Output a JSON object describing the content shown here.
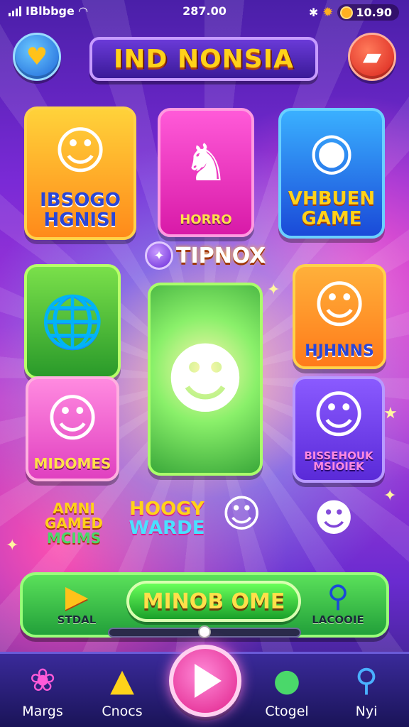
{
  "status_bar": {
    "carrier": "IBlbbge",
    "time": "287.00",
    "currency": "10.90"
  },
  "header": {
    "title": "IND NONSIA",
    "heart_icon": "heart-icon",
    "chest_icon": "chest-icon"
  },
  "cards": {
    "card1": {
      "label_line1": "IBSOGO",
      "label_line2": "HGNISI"
    },
    "card2": {
      "label": "HORRO"
    },
    "card3": {
      "label_line1": "VHBUEN",
      "label_line2": "GAME"
    },
    "card6": {
      "label": "HJHNNS"
    },
    "card7": {
      "label": "MIDOMES"
    },
    "card8": {
      "label_line1": "BISSEHOUK",
      "label_line2": "MSIOIEK"
    }
  },
  "featured_tag": "TIPNOX",
  "floating_labels": {
    "left": {
      "line1": "AMNI",
      "line2": "GAMED",
      "line3": "MCIMS"
    },
    "center": {
      "line1": "HOOGY",
      "line2": "WARDE"
    }
  },
  "panel": {
    "left_label": "STDAL",
    "cta_label": "MINOB OME",
    "right_label": "LACOOIE",
    "slider_value": 0.5
  },
  "nav": {
    "items": [
      {
        "label": "Margs",
        "icon": "berry-icon"
      },
      {
        "label": "Cnocs",
        "icon": "nacho-icon"
      },
      {
        "label": "Ctogel",
        "icon": "orb-icon"
      },
      {
        "label": "Nyi",
        "icon": "search-icon"
      }
    ],
    "play_icon": "play-icon"
  },
  "colors": {
    "title_text": "#ffd21a",
    "panel_green": "#22a03a",
    "play_pink": "#e0208a"
  }
}
